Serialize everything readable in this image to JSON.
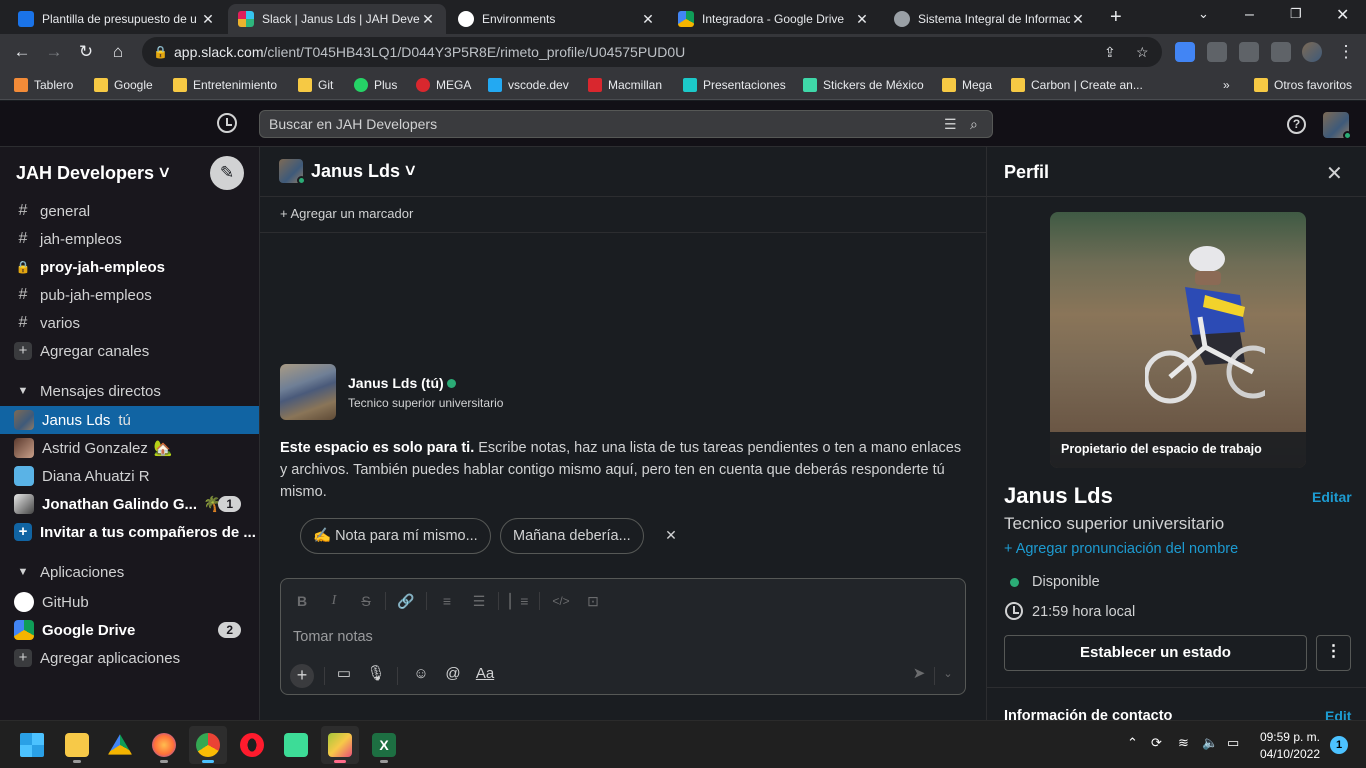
{
  "browser": {
    "tabs": [
      {
        "title": "Plantilla de presupuesto de u",
        "color": "#1a73e8"
      },
      {
        "title": "Slack | Janus Lds | JAH Develo",
        "color": "#e01e5a"
      },
      {
        "title": "Environments",
        "color": "#ffffff"
      },
      {
        "title": "Integradora - Google Drive",
        "color": "#0f9d58"
      },
      {
        "title": "Sistema Integral de Informac",
        "color": "#9aa0a6"
      }
    ],
    "new_tab": "+",
    "url_host": "app.slack.com",
    "url_path": "/client/T045HB43LQ1/D044Y3P5R8E/rimeto_profile/U04575PUD0U",
    "bookmarks": [
      {
        "label": "Tablero",
        "color": "#f28b38"
      },
      {
        "label": "Google",
        "color": "#f6c944"
      },
      {
        "label": "Entretenimiento",
        "color": "#f6c944"
      },
      {
        "label": "Git",
        "color": "#f6c944"
      },
      {
        "label": "Plus",
        "color": "#25d366"
      },
      {
        "label": "MEGA",
        "color": "#d9272e"
      },
      {
        "label": "vscode.dev",
        "color": "#23a9f2"
      },
      {
        "label": "Macmillan",
        "color": "#d9272e"
      },
      {
        "label": "Presentaciones",
        "color": "#1cc9c9"
      },
      {
        "label": "Stickers de México",
        "color": "#3fd8a8"
      },
      {
        "label": "Mega",
        "color": "#f6c944"
      },
      {
        "label": "Carbon | Create an...",
        "color": "#f6c944"
      }
    ],
    "bookmarks_overflow": "»",
    "other_bookmarks": "Otros favoritos"
  },
  "slack": {
    "search_placeholder": "Buscar en JAH Developers",
    "help": "?",
    "workspace_name": "JAH Developers ˅",
    "channels": [
      {
        "prefix": "#",
        "label": "general",
        "bold": false
      },
      {
        "prefix": "#",
        "label": "jah-empleos",
        "bold": false
      },
      {
        "prefix": "🔒",
        "label": "proy-jah-empleos",
        "bold": true
      },
      {
        "prefix": "#",
        "label": "pub-jah-empleos",
        "bold": false
      },
      {
        "prefix": "#",
        "label": "varios",
        "bold": false
      }
    ],
    "add_channels": "Agregar canales",
    "dm_section": "Mensajes directos",
    "dms": [
      {
        "label": "Janus Lds",
        "suffix": "tú",
        "emoji": "",
        "badge": "",
        "bold": false,
        "active": true
      },
      {
        "label": "Astrid Gonzalez",
        "suffix": "",
        "emoji": "🏡",
        "badge": "",
        "bold": false,
        "active": false
      },
      {
        "label": "Diana Ahuatzi R",
        "suffix": "",
        "emoji": "",
        "badge": "",
        "bold": false,
        "active": false
      },
      {
        "label": "Jonathan Galindo G...",
        "suffix": "",
        "emoji": "🌴",
        "badge": "1",
        "bold": true,
        "active": false
      }
    ],
    "invite": "Invitar a tus compañeros de ...",
    "apps_section": "Aplicaciones",
    "apps": [
      {
        "label": "GitHub",
        "badge": "",
        "bold": false
      },
      {
        "label": "Google Drive",
        "badge": "2",
        "bold": true
      }
    ],
    "add_apps": "Agregar aplicaciones",
    "channel_header": "Janus Lds ˅",
    "add_bookmark": "+  Agregar un marcador",
    "intro": {
      "name": "Janus Lds (tú)",
      "title": "Tecnico superior universitario",
      "bold_text": "Este espacio es solo para ti.",
      "text": " Escribe notas, haz una lista de tus tareas pendientes o ten a mano enlaces y archivos. También puedes hablar contigo mismo aquí, pero ten en cuenta que deberás responderte tú mismo."
    },
    "chips": [
      "✍️  Nota para mí mismo...",
      "Mañana debería..."
    ],
    "chip_close": "✕",
    "composer_placeholder": "Tomar notas",
    "format_aa": "Aa"
  },
  "profile": {
    "title": "Perfil",
    "badge": "Propietario del espacio de trabajo",
    "name": "Janus Lds",
    "edit": "Editar",
    "role": "Tecnico superior universitario",
    "pronunciation": "+ Agregar pronunciación del nombre",
    "status": "Disponible",
    "local_time": "21:59 hora local",
    "set_status": "Establecer un estado",
    "more": "⋮",
    "contact_title": "Información de contacto",
    "contact_edit": "Edit"
  },
  "taskbar": {
    "apps": [
      {
        "name": "windows-start",
        "color": "#4cc2ff",
        "active": false
      },
      {
        "name": "file-explorer",
        "color": "#f7c948",
        "active": false
      },
      {
        "name": "google-drive",
        "color": "#0f9d58",
        "active": false
      },
      {
        "name": "firefox",
        "color": "#ff7139",
        "active": false
      },
      {
        "name": "chrome",
        "color": "#ea4335",
        "active": true
      },
      {
        "name": "opera",
        "color": "#ff1b2d",
        "active": false
      },
      {
        "name": "discord-like",
        "color": "#3ddc97",
        "active": false
      },
      {
        "name": "bluestacks",
        "color": "#a4c639",
        "active": true
      },
      {
        "name": "excel",
        "color": "#1d6f42",
        "active": false
      }
    ],
    "time": "09:59 p. m.",
    "date": "04/10/2022",
    "notifications": "1"
  }
}
